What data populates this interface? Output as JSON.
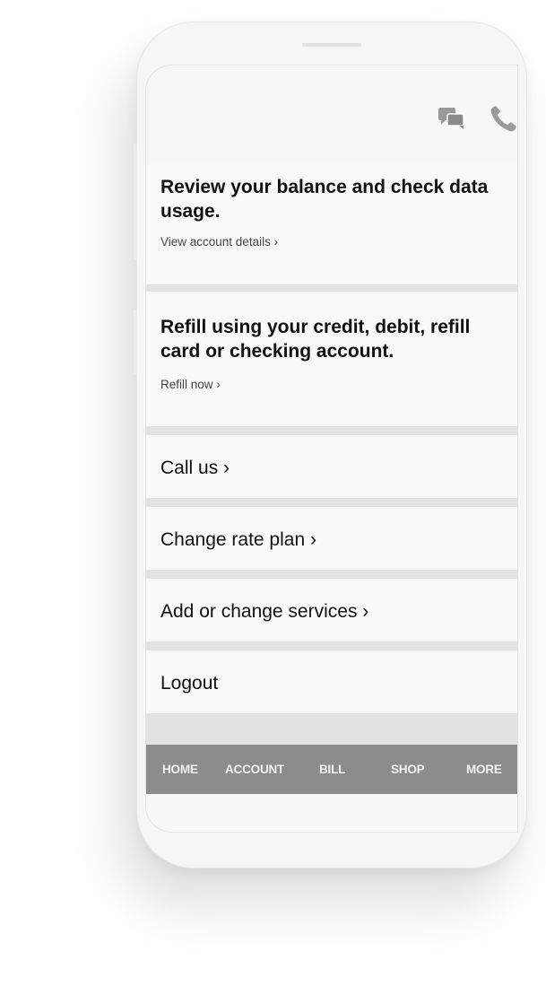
{
  "header": {
    "icons": [
      "chat-icon",
      "phone-icon"
    ]
  },
  "cards": [
    {
      "title": "Review your balance and check data usage.",
      "link": "View account details ›"
    },
    {
      "title": "Refill using your credit, debit, refill card or checking account.",
      "link": "Refill now ›"
    }
  ],
  "rows": [
    {
      "label": "Call us ›"
    },
    {
      "label": "Change rate plan ›"
    },
    {
      "label": "Add or change services ›"
    },
    {
      "label": "Logout"
    }
  ],
  "tabs": [
    {
      "label": "HOME"
    },
    {
      "label": "ACCOUNT"
    },
    {
      "label": "BILL"
    },
    {
      "label": "SHOP"
    },
    {
      "label": "MORE"
    }
  ],
  "colors": {
    "tab_bar": "#8c8c8c",
    "separator": "#e2e2e2",
    "icon": "#9a9a9a"
  }
}
